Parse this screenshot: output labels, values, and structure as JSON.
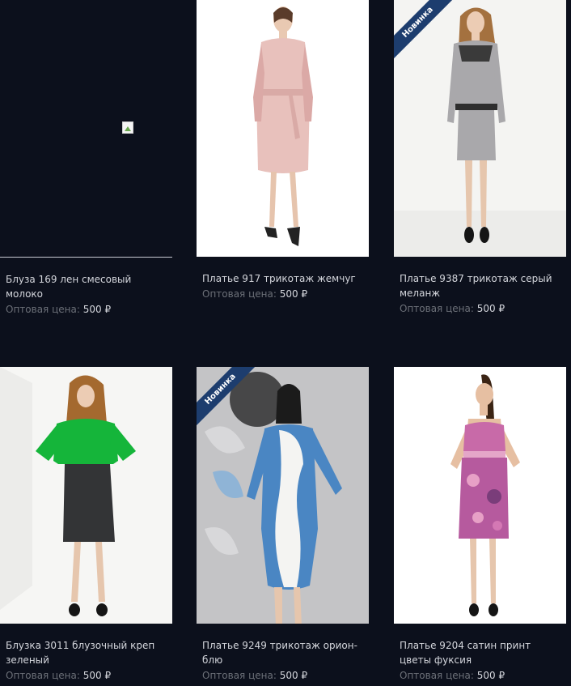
{
  "products": [
    {
      "title": "Блуза 169 лен смесовый молоко",
      "price_label": "Оптовая цена:",
      "price": "500",
      "currency": "₽",
      "badge": ""
    },
    {
      "title": "Платье 917 трикотаж жемчуг",
      "price_label": "Оптовая цена:",
      "price": "500",
      "currency": "₽",
      "badge": ""
    },
    {
      "title": "Платье 9387 трикотаж серый меланж",
      "price_label": "Оптовая цена:",
      "price": "500",
      "currency": "₽",
      "badge": "Новинка"
    },
    {
      "title": "Блузка 3011 блузочный креп зеленый",
      "price_label": "Оптовая цена:",
      "price": "500",
      "currency": "₽",
      "badge": ""
    },
    {
      "title": "Платье 9249 трикотаж орион-блю",
      "price_label": "Оптовая цена:",
      "price": "500",
      "currency": "₽",
      "badge": "Новинка"
    },
    {
      "title": "Платье 9204 сатин принт цветы фуксия",
      "price_label": "Оптовая цена:",
      "price": "500",
      "currency": "₽",
      "badge": ""
    }
  ],
  "colors": {
    "page_background": "#0c101c",
    "badge_background": "#1d3d6e",
    "title_text": "#d4d6dc",
    "price_label_text": "#6c7078"
  }
}
